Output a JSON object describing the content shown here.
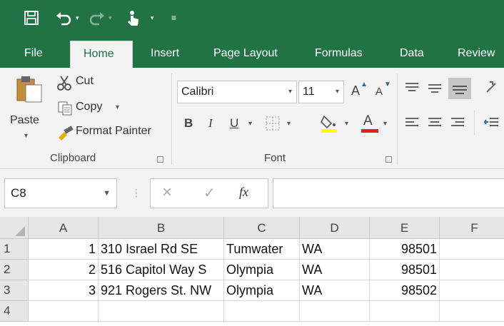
{
  "quick_access": {
    "save_icon": "save-icon",
    "undo_icon": "undo-icon",
    "redo_icon": "redo-icon",
    "touch_icon": "touch-mode-icon",
    "customize_icon": "customize-qat-icon"
  },
  "tabs": [
    {
      "label": "File"
    },
    {
      "label": "Home",
      "active": true
    },
    {
      "label": "Insert"
    },
    {
      "label": "Page Layout"
    },
    {
      "label": "Formulas"
    },
    {
      "label": "Data"
    },
    {
      "label": "Review"
    }
  ],
  "ribbon": {
    "clipboard": {
      "group_label": "Clipboard",
      "paste_label": "Paste",
      "cut_label": "Cut",
      "copy_label": "Copy",
      "format_painter_label": "Format Painter"
    },
    "font": {
      "group_label": "Font",
      "font_name": "Calibri",
      "font_size": "11",
      "bold_label": "B",
      "italic_label": "I",
      "underline_label": "U",
      "font_color_label": "A",
      "grow_label": "A",
      "shrink_label": "A"
    }
  },
  "formula_bar": {
    "name_box": "C8",
    "fx_label": "fx",
    "cancel_symbol": "×",
    "enter_symbol": "✓",
    "content": ""
  },
  "sheet": {
    "columns": [
      "A",
      "B",
      "C",
      "D",
      "E",
      "F"
    ],
    "rows": [
      {
        "num": "1",
        "A": "1",
        "B": "310 Israel Rd SE",
        "C": "Tumwater",
        "D": "WA",
        "E": "98501"
      },
      {
        "num": "2",
        "A": "2",
        "B": "516 Capitol Way S",
        "C": "Olympia",
        "D": "WA",
        "E": "98501"
      },
      {
        "num": "3",
        "A": "3",
        "B": "921 Rogers St. NW",
        "C": "Olympia",
        "D": "WA",
        "E": "98502"
      },
      {
        "num": "4",
        "A": "",
        "B": "",
        "C": "",
        "D": "",
        "E": ""
      }
    ]
  },
  "colors": {
    "accent": "#217346",
    "ribbon_bg": "#f3f3f3",
    "header_bg": "#e6e6e6",
    "font_color_bar": "#e02020",
    "highlight_bar": "#ffff00"
  }
}
